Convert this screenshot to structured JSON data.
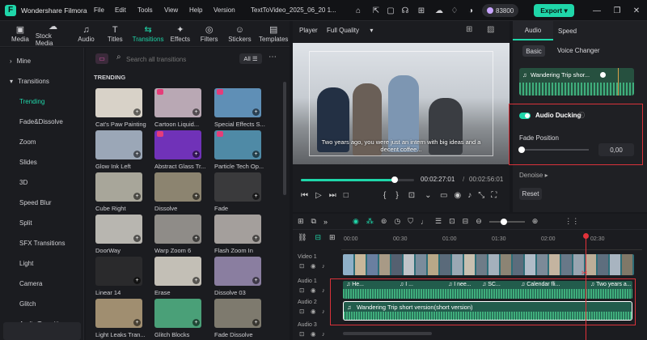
{
  "app": {
    "name": "Wondershare Filmora",
    "project_title": "TextToVideo_2025_06_20 1...",
    "credits": "83800",
    "export_label": "Export"
  },
  "menu": [
    "File",
    "Edit",
    "Tools",
    "View",
    "Help",
    "Version"
  ],
  "toolbar": {
    "items": [
      {
        "label": "Media",
        "icon": "▣"
      },
      {
        "label": "Stock Media",
        "icon": "☁"
      },
      {
        "label": "Audio",
        "icon": "♫"
      },
      {
        "label": "Titles",
        "icon": "T"
      },
      {
        "label": "Transitions",
        "icon": "⇆"
      },
      {
        "label": "Effects",
        "icon": "✦"
      },
      {
        "label": "Filters",
        "icon": "◎"
      },
      {
        "label": "Stickers",
        "icon": "☺"
      },
      {
        "label": "Templates",
        "icon": "▤"
      }
    ]
  },
  "sidebar": {
    "items": [
      {
        "label": "Mine",
        "head": true,
        "arrow": "›"
      },
      {
        "label": "Transitions",
        "head": true,
        "arrow": "▾"
      },
      {
        "label": "Trending",
        "active": true
      },
      {
        "label": "Fade&Dissolve"
      },
      {
        "label": "Zoom"
      },
      {
        "label": "Slides"
      },
      {
        "label": "3D"
      },
      {
        "label": "Speed Blur"
      },
      {
        "label": "Split"
      },
      {
        "label": "SFX Transitions"
      },
      {
        "label": "Light"
      },
      {
        "label": "Camera"
      },
      {
        "label": "Glitch"
      },
      {
        "label": "Audio Transiti..."
      }
    ]
  },
  "browser": {
    "search_placeholder": "Search all transitions",
    "filter": "All",
    "section": "TRENDING",
    "items": [
      {
        "label": "Cat's Paw Painting",
        "color": "#d8d2c8",
        "gem": false
      },
      {
        "label": "Cartoon Liquid...",
        "color": "#b9a8b4",
        "gem": true
      },
      {
        "label": "Special Effects S...",
        "color": "#5f8fb6",
        "gem": true
      },
      {
        "label": "Glow Ink Left",
        "color": "#9ba7b7",
        "gem": false
      },
      {
        "label": "Abstract Glass Tr...",
        "color": "#7032b8",
        "gem": true
      },
      {
        "label": "Particle Tech Op...",
        "color": "#4f8aa6",
        "gem": true
      },
      {
        "label": "Cube Right",
        "color": "#a8a69a",
        "gem": false
      },
      {
        "label": "Dissolve",
        "color": "#8c8470",
        "gem": false
      },
      {
        "label": "Fade",
        "color": "#3a3a3c",
        "gem": false
      },
      {
        "label": "DoorWay",
        "color": "#b8b6b0",
        "gem": false
      },
      {
        "label": "Warp Zoom 6",
        "color": "#8f8c88",
        "gem": false
      },
      {
        "label": "Flash Zoom In",
        "color": "#a49f9c",
        "gem": false
      },
      {
        "label": "Linear 14",
        "color": "#2a2a2c",
        "gem": false
      },
      {
        "label": "Erase",
        "color": "#c3bfb6",
        "gem": false
      },
      {
        "label": "Dissolve 03",
        "color": "#8a7ea0",
        "gem": false
      },
      {
        "label": "Light Leaks Tran...",
        "color": "#a08e70",
        "gem": false
      },
      {
        "label": "Glitch Blocks",
        "color": "#4aa078",
        "gem": false
      },
      {
        "label": "Fade Dissolve",
        "color": "#7e7a6e",
        "gem": false
      }
    ]
  },
  "player": {
    "label": "Player",
    "quality": "Full Quality",
    "subtitle": "Two years ago, you were just an intern with big ideas and a decent coffee...",
    "current_time": "00:02:27:01",
    "total_time": "00:02:56:01",
    "progress": 0.83
  },
  "panel": {
    "tabs": [
      "Audio",
      "Speed"
    ],
    "subtabs": [
      "Basic",
      "Voice Changer"
    ],
    "clip_name": "Wandering Trip shor...",
    "ducking_label": "Audio Ducking",
    "fade_label": "Fade Position",
    "fade_value": "0,00",
    "denoise_label": "Denoise",
    "reset_label": "Reset"
  },
  "timeline": {
    "ruler": [
      "00:00",
      "00:30",
      "01:00",
      "01:30",
      "02:00",
      "02:30"
    ],
    "tracks": [
      "Video 1",
      "Audio 1",
      "Audio 2",
      "Audio 3"
    ],
    "audio1_clips": [
      "He...",
      "I ...",
      "I nee...",
      "SC...",
      "Calendar fli...",
      "Two years a..."
    ],
    "audio2_clip": "Wandering Trip short version(short version)"
  }
}
